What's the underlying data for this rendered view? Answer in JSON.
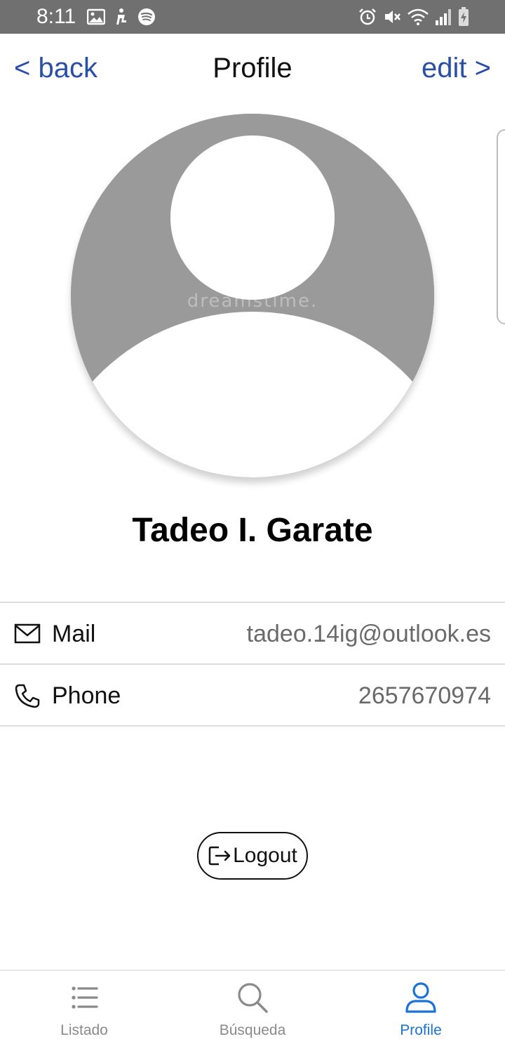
{
  "status_bar": {
    "time": "8:11",
    "left_icons": [
      "image-icon",
      "accessibility-icon",
      "spotify-icon"
    ],
    "right_icons": [
      "alarm-icon",
      "mute-icon",
      "wifi-icon",
      "signal-icon",
      "battery-charging-icon"
    ]
  },
  "header": {
    "back_label": "< back",
    "title": "Profile",
    "edit_label": "edit >"
  },
  "avatar": {
    "icon": "user-silhouette-icon",
    "watermark": "dreamstime."
  },
  "profile": {
    "name": "Tadeo I. Garate"
  },
  "info": {
    "mail": {
      "label": "Mail",
      "value": "tadeo.14ig@outlook.es",
      "icon": "mail-icon"
    },
    "phone": {
      "label": "Phone",
      "value": "2657670974",
      "icon": "phone-icon"
    }
  },
  "logout": {
    "label": "Logout",
    "icon": "logout-icon"
  },
  "bottom_nav": {
    "items": [
      {
        "label": "Listado",
        "icon": "list-icon",
        "active": false
      },
      {
        "label": "Búsqueda",
        "icon": "search-icon",
        "active": false
      },
      {
        "label": "Profile",
        "icon": "user-icon",
        "active": true
      }
    ]
  },
  "colors": {
    "accent": "#2a4fa8",
    "nav_active": "#1a73d6",
    "status_bar": "#707070",
    "avatar_bg": "#9a9a9a"
  }
}
